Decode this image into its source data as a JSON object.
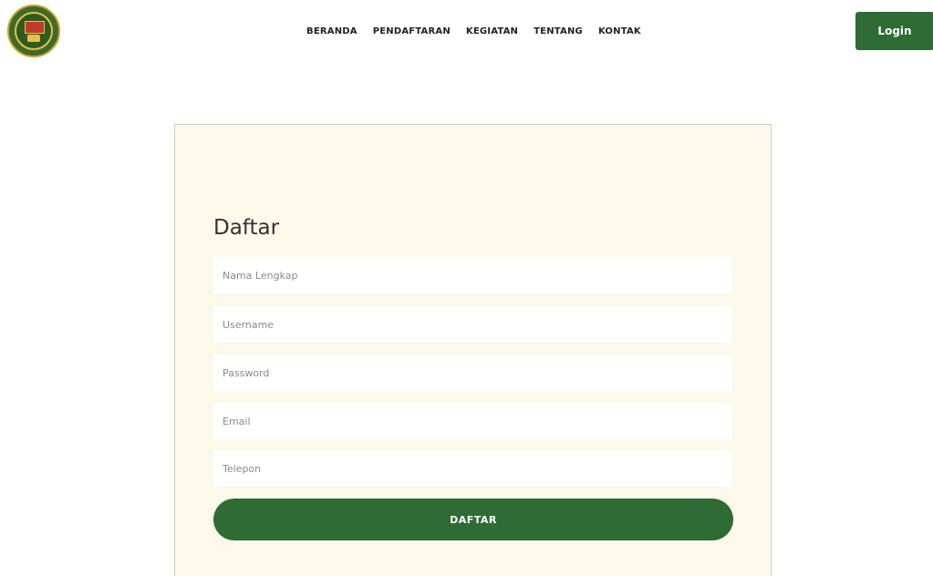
{
  "header": {
    "logo_icon": "organization-emblem-icon",
    "nav": [
      {
        "label": "BERANDA"
      },
      {
        "label": "PENDAFTARAN"
      },
      {
        "label": "KEGIATAN"
      },
      {
        "label": "TENTANG"
      },
      {
        "label": "KONTAK"
      }
    ],
    "login_label": "Login"
  },
  "form": {
    "title": "Daftar",
    "fields": [
      {
        "placeholder": "Nama Lengkap",
        "value": ""
      },
      {
        "placeholder": "Username",
        "value": ""
      },
      {
        "placeholder": "Password",
        "value": ""
      },
      {
        "placeholder": "Email",
        "value": ""
      },
      {
        "placeholder": "Telepon",
        "value": ""
      }
    ],
    "submit_label": "DAFTAR"
  },
  "colors": {
    "primary_green": "#2f6b35",
    "card_background": "#fcf8ea",
    "card_border": "#c9d3b8"
  }
}
